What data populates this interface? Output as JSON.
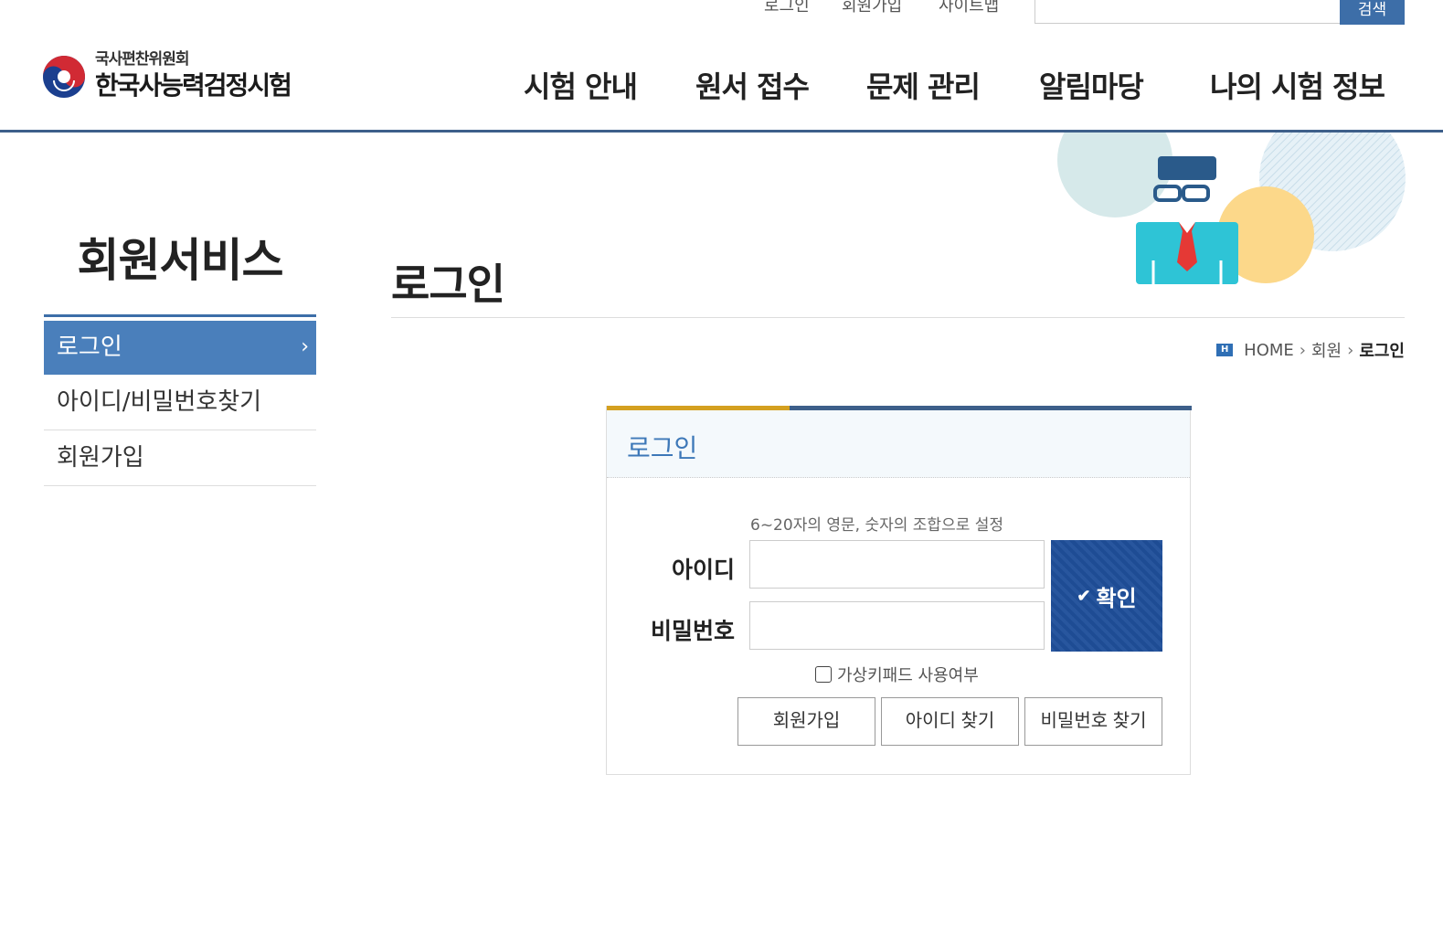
{
  "util_nav": {
    "login": "로그인",
    "join": "회원가입",
    "sitemap": "사이트맵",
    "search_placeholder": "",
    "search_button": "검색"
  },
  "logo": {
    "sub": "국사편찬위원회",
    "main": "한국사능력검정시험"
  },
  "gnb": [
    "시험 안내",
    "원서 접수",
    "문제 관리",
    "알림마당",
    "나의 시험 정보"
  ],
  "side": {
    "title": "회원서비스",
    "items": [
      {
        "label": "로그인",
        "active": true
      },
      {
        "label": "아이디/비밀번호찾기",
        "active": false
      },
      {
        "label": "회원가입",
        "active": false
      }
    ],
    "arrow": "›"
  },
  "page": {
    "title": "로그인"
  },
  "breadcrumb": {
    "home_icon_text": "H",
    "home": "HOME",
    "sep": "›",
    "level1": "회원",
    "current": "로그인"
  },
  "login": {
    "box_title": "로그인",
    "hint": "6~20자의 영문, 숫자의 조합으로 설정",
    "id_label": "아이디",
    "pw_label": "비밀번호",
    "id_value": "",
    "pw_value": "",
    "confirm_check": "✔",
    "confirm_label": "확인",
    "virtual_keypad_label": "가상키패드 사용여부",
    "virtual_keypad_checked": false,
    "buttons": [
      "회원가입",
      "아이디 찾기",
      "비밀번호 찾기"
    ]
  },
  "colors": {
    "brand_blue": "#3d6ea8",
    "header_line": "#3d5f8a",
    "side_active": "#4a7fbb",
    "accent_gold": "#d4a020",
    "confirm_bg": "#1f4f9a",
    "title_blue": "#3d78b8"
  }
}
